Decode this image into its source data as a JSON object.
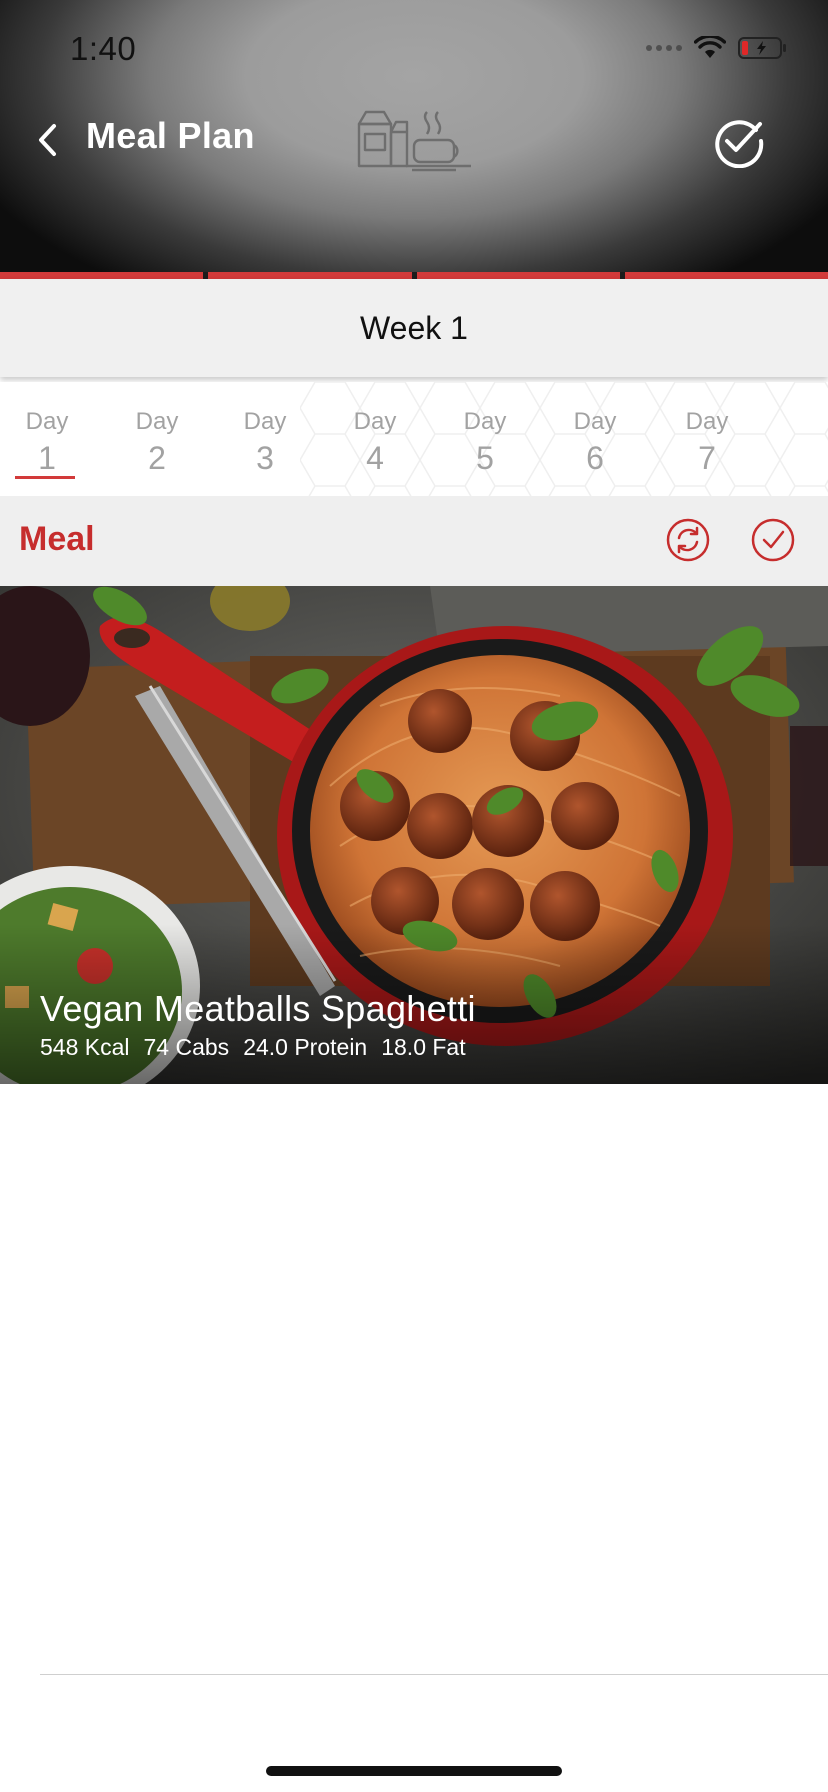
{
  "status_bar": {
    "time": "1:40"
  },
  "nav": {
    "back_icon": "chevron-left-icon",
    "title": "Meal Plan",
    "illustration_icon": "breakfast-icon",
    "action_icon": "check-circle-icon"
  },
  "progress": {
    "segments": 4,
    "active_color": "#d23a3a"
  },
  "week": {
    "label": "Week 1"
  },
  "days": [
    {
      "label": "Day",
      "number": "1",
      "selected": true
    },
    {
      "label": "Day",
      "number": "2"
    },
    {
      "label": "Day",
      "number": "3"
    },
    {
      "label": "Day",
      "number": "4"
    },
    {
      "label": "Day",
      "number": "5"
    },
    {
      "label": "Day",
      "number": "6"
    },
    {
      "label": "Day",
      "number": "7"
    }
  ],
  "meal": {
    "label": "Meal",
    "refresh_icon": "refresh-icon",
    "check_icon": "check-circle-icon",
    "card": {
      "title": "Vegan Meatballs Spaghetti",
      "kcal": "548 Kcal",
      "carbs": "74 Cabs",
      "protein": "24.0 Protein",
      "fat": "18.0 Fat"
    }
  },
  "colors": {
    "accent": "#c62d2d",
    "header_bg": "#9c9c9c",
    "bar_bg": "#efefef"
  }
}
